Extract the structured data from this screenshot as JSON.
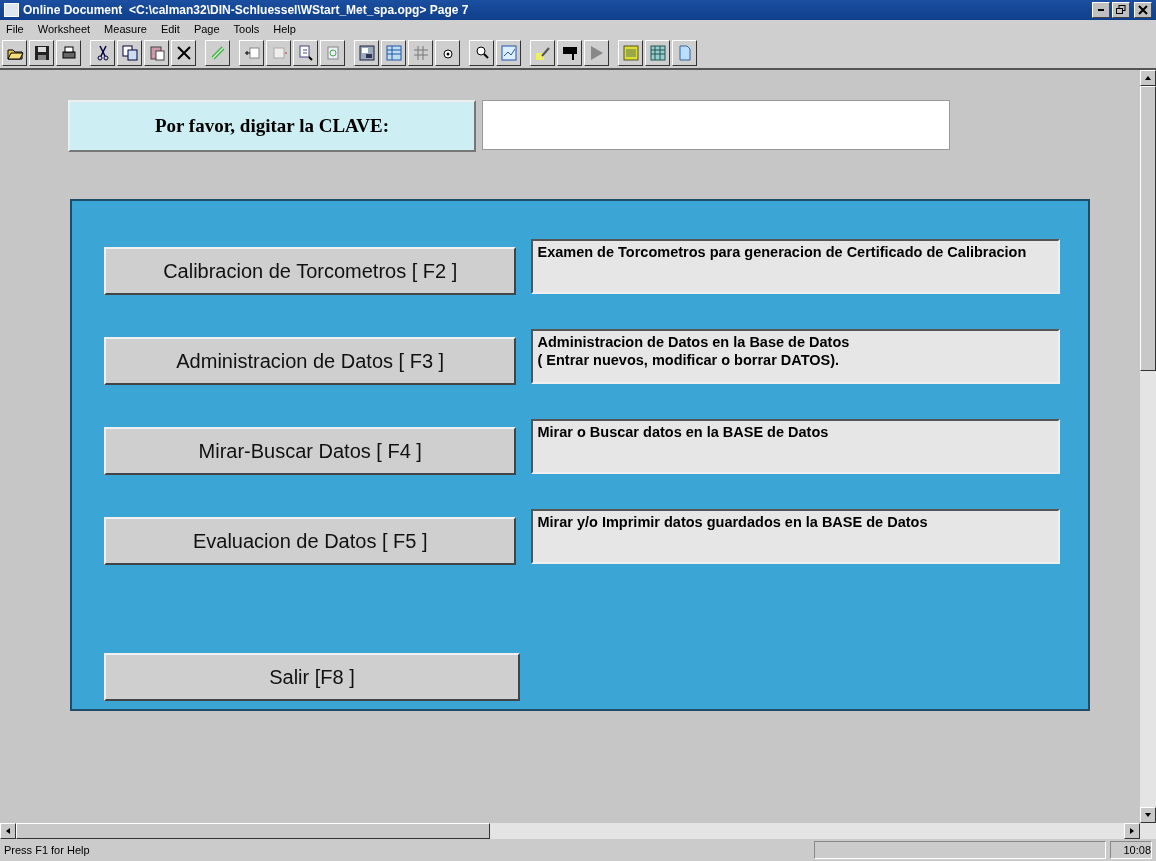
{
  "window": {
    "title": "Online Document  <C:\\calman32\\DIN-Schluessel\\WStart_Met_spa.opg> Page 7"
  },
  "menu": [
    "File",
    "Worksheet",
    "Measure",
    "Edit",
    "Page",
    "Tools",
    "Help"
  ],
  "password": {
    "label": "Por favor, digitar la CLAVE:"
  },
  "actions": [
    {
      "button": "Calibracion de Torcometros [ F2 ]",
      "description": "Examen de Torcometros para generacion de Certificado de Calibracion"
    },
    {
      "button": "Administracion de Datos [ F3 ]",
      "description": "Administracion de Datos en la Base de Datos\n( Entrar nuevos, modificar o borrar DATOS)."
    },
    {
      "button": "Mirar-Buscar Datos [ F4 ]",
      "description": "Mirar o Buscar datos en la BASE de Datos"
    },
    {
      "button": "Evaluacion de Datos [ F5 ]",
      "description": "Mirar y/o Imprimir datos guardados en la BASE de Datos"
    }
  ],
  "exit_button": "Salir  [F8 ]",
  "status_bar": {
    "message": "Press F1 for Help",
    "time": "10:08"
  }
}
